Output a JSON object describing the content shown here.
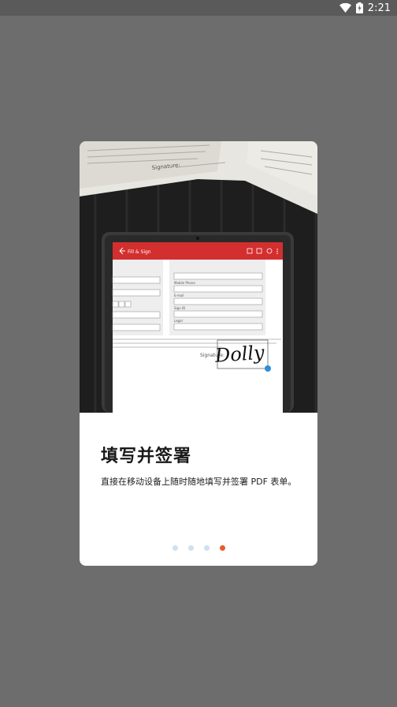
{
  "status_bar": {
    "time": "2:21",
    "icons": [
      "wifi-icon",
      "battery-charging-icon"
    ]
  },
  "hero": {
    "paper_text": "Signature:",
    "app_title": "Fill & Sign",
    "field_labels": [
      "Mobile Phone",
      "E-mail",
      "Sign ID",
      "Legal"
    ],
    "signature_label": "Signature:",
    "signature_text": "Dolly"
  },
  "onboarding": {
    "title": "填写并签署",
    "description": "直接在移动设备上随时随地填写并签署 PDF 表单。",
    "page_count": 4,
    "active_page": 4
  },
  "colors": {
    "background": "#6d6d6d",
    "accent": "#d32f2f",
    "dot_active": "#e85a2a",
    "dot_inactive": "#cfe0ee"
  }
}
